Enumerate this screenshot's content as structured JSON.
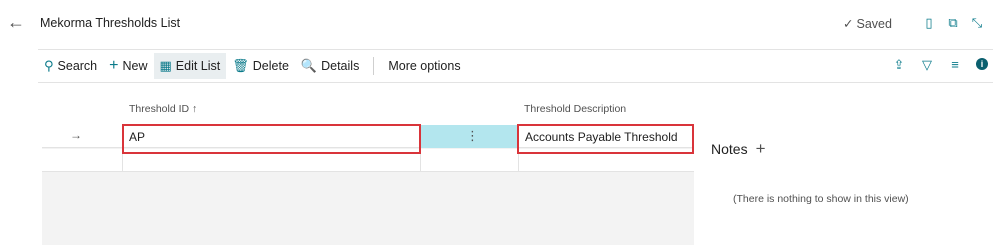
{
  "page": {
    "title": "Mekorma Thresholds List",
    "saved": "Saved"
  },
  "icons": {
    "back": "arrow-left-icon",
    "saved": "checkmark-icon",
    "bookmark": "bookmark-icon",
    "open_new": "open-in-new-window-icon",
    "collapse": "collapse-icon",
    "share": "share-icon",
    "filter": "filter-icon",
    "list": "list-icon",
    "info": "info-icon"
  },
  "actions": {
    "search": "Search",
    "new": "New",
    "edit_list": "Edit List",
    "delete": "Delete",
    "details": "Details",
    "more": "More options"
  },
  "grid": {
    "columns": [
      "Threshold ID",
      "Threshold Description"
    ],
    "sort_indicator": "↑",
    "rows": [
      {
        "id": "AP",
        "description": "Accounts Payable Threshold"
      }
    ]
  },
  "notes": {
    "title": "Notes",
    "empty": "(There is nothing to show in this view)"
  },
  "colors": {
    "accent": "#0a7a8a",
    "highlight": "#d9343a",
    "selection": "#b3e6ee"
  }
}
